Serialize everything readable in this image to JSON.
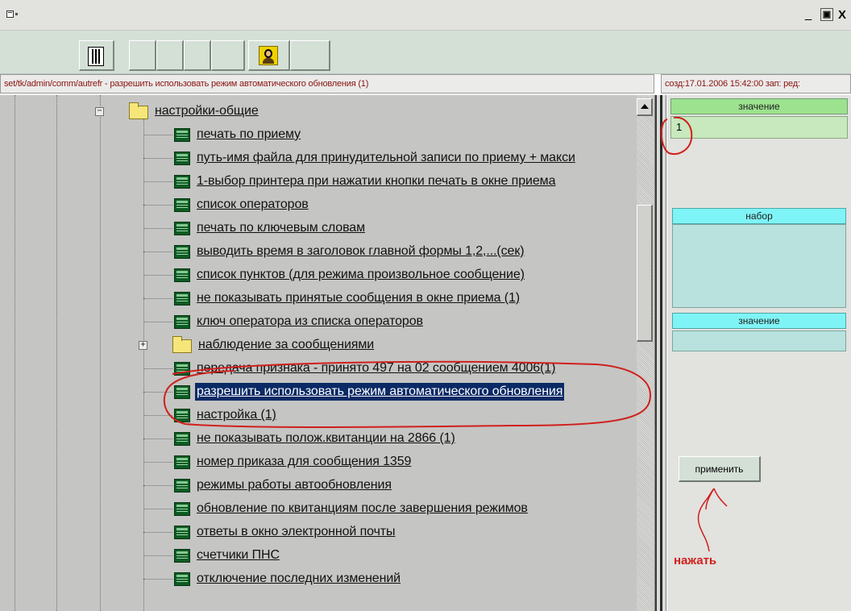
{
  "window": {
    "title": "",
    "controls": {
      "minimize": "_",
      "maximize": "▣",
      "close": "X"
    }
  },
  "toolbar": {
    "buttons": [
      {
        "icon": "panel-icon"
      },
      {
        "icon": ""
      },
      {
        "icon": ""
      },
      {
        "icon": ""
      },
      {
        "icon": ""
      },
      {
        "icon": "user-icon"
      },
      {
        "icon": ""
      }
    ]
  },
  "path_bar": {
    "text": "set/tk/admin/comm/autrefr - разрешить использовать режим автоматического обновления (1)"
  },
  "info_bar": {
    "text": "созд:17.01.2006 15:42:00 зап: ред:"
  },
  "tree": {
    "folder_open": {
      "label": "настройки-общие",
      "expander": "−"
    },
    "items_top": [
      "печать по приему",
      "путь-имя файла для принудительной записи по приему + макси",
      "1-выбор принтера при нажатии кнопки печать в окне приема",
      "список операторов",
      "печать по ключевым словам",
      "выводить время в заголовок главной формы 1,2,...(сек)",
      "список пунктов (для режима произвольное сообщение)",
      "не показывать принятые сообщения в окне приема (1)",
      "ключ оператора из списка операторов"
    ],
    "folder_closed": {
      "label": "наблюдение за сообщениями",
      "expander": "+"
    },
    "items_bottom": [
      "передача признака - принято 497 на 02 сообщением 4006(1)",
      "разрешить использовать режим автоматического обновления",
      "настройка (1)",
      "не показывать полож.квитанции на 2866 (1)",
      "номер приказа для сообщения 1359",
      "режимы работы автообновления",
      "обновление по квитанциям после завершения режимов",
      "ответы в окно электронной почты",
      "счетчики ПНС",
      "отключение последних изменений"
    ],
    "selected_item": "разрешить использовать режим автоматического обновления"
  },
  "right_panel": {
    "value_header": "значение",
    "value": "1",
    "set_header": "набор",
    "value2_header": "значение",
    "value2": "",
    "apply_label": "применить"
  },
  "annotation": {
    "label": "нажать",
    "color": "#d0201c"
  },
  "colors": {
    "selection": "#0a2a66",
    "path_text": "#8a1410",
    "header_green": "#9ce28f",
    "header_cyan": "#7ff4f6"
  }
}
